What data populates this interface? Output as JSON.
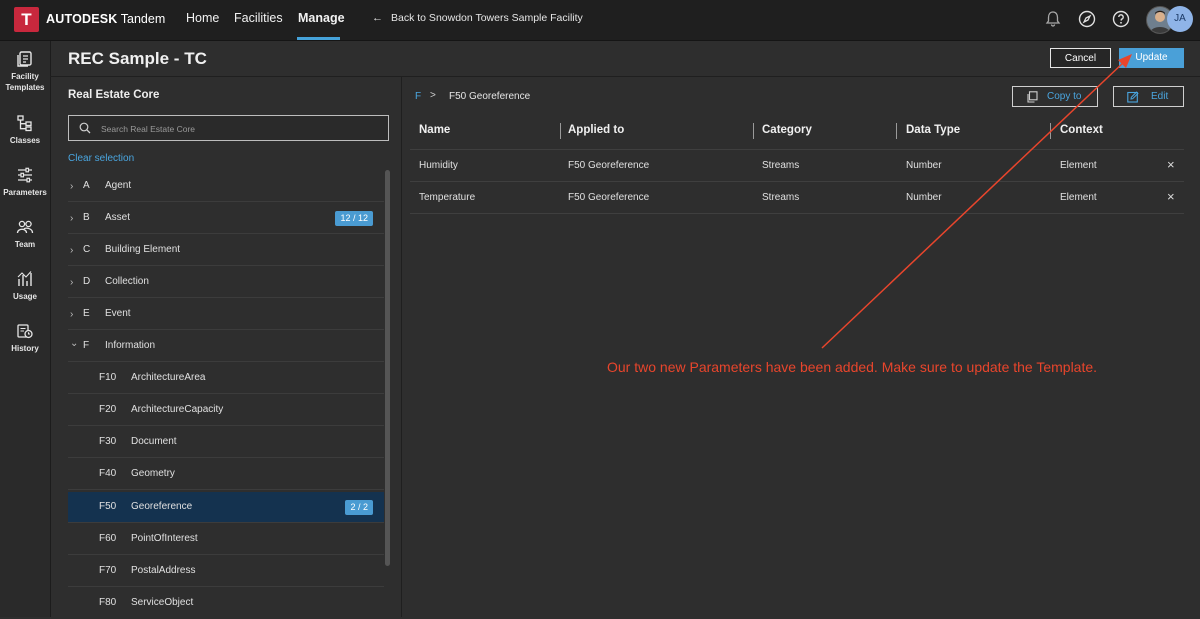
{
  "app": {
    "logo_letter": "T",
    "brand_bold": "AUTODESK",
    "brand_product": "Tandem"
  },
  "nav": {
    "home": "Home",
    "facilities": "Facilities",
    "manage": "Manage"
  },
  "back_link": "Back to Snowdon Towers Sample Facility",
  "user": {
    "initials": "JA"
  },
  "rail": {
    "facility_templates_1": "Facility",
    "facility_templates_2": "Templates",
    "classes": "Classes",
    "parameters": "Parameters",
    "team": "Team",
    "usage": "Usage",
    "history": "History"
  },
  "page_title": "REC Sample - TC",
  "buttons": {
    "cancel": "Cancel",
    "update": "Update",
    "copy_to": "Copy to",
    "edit": "Edit"
  },
  "left_panel": {
    "title": "Real Estate Core",
    "search_placeholder": "Search Real Estate Core",
    "clear_selection": "Clear selection",
    "tree": [
      {
        "chev": "›",
        "code": "A",
        "label": "Agent",
        "badge": ""
      },
      {
        "chev": "›",
        "code": "B",
        "label": "Asset",
        "badge": "12 / 12"
      },
      {
        "chev": "›",
        "code": "C",
        "label": "Building Element",
        "badge": ""
      },
      {
        "chev": "›",
        "code": "D",
        "label": "Collection",
        "badge": ""
      },
      {
        "chev": "›",
        "code": "E",
        "label": "Event",
        "badge": ""
      },
      {
        "chev": "⌄",
        "code": "F",
        "label": "Information",
        "badge": ""
      }
    ],
    "children": [
      {
        "code": "F10",
        "label": "ArchitectureArea",
        "badge": ""
      },
      {
        "code": "F20",
        "label": "ArchitectureCapacity",
        "badge": ""
      },
      {
        "code": "F30",
        "label": "Document",
        "badge": ""
      },
      {
        "code": "F40",
        "label": "Geometry",
        "badge": ""
      },
      {
        "code": "F50",
        "label": "Georeference",
        "badge": "2 / 2"
      },
      {
        "code": "F60",
        "label": "PointOfInterest",
        "badge": ""
      },
      {
        "code": "F70",
        "label": "PostalAddress",
        "badge": ""
      },
      {
        "code": "F80",
        "label": "ServiceObject",
        "badge": ""
      }
    ]
  },
  "breadcrumb": {
    "root": "F",
    "separator": ">",
    "current": "F50 Georeference"
  },
  "table": {
    "columns": [
      "Name",
      "Applied to",
      "Category",
      "Data Type",
      "Context"
    ],
    "rows": [
      [
        "Humidity",
        "F50 Georeference",
        "Streams",
        "Number",
        "Element"
      ],
      [
        "Temperature",
        "F50 Georeference",
        "Streams",
        "Number",
        "Element"
      ]
    ],
    "remove_icon": "×"
  },
  "annotation": "Our two new Parameters have been added.  Make sure to update the Template.",
  "colors": {
    "accent": "#4aa0d8",
    "selected_row": "#14324f",
    "annotation": "#e8452c",
    "logo": "#c8283d"
  }
}
